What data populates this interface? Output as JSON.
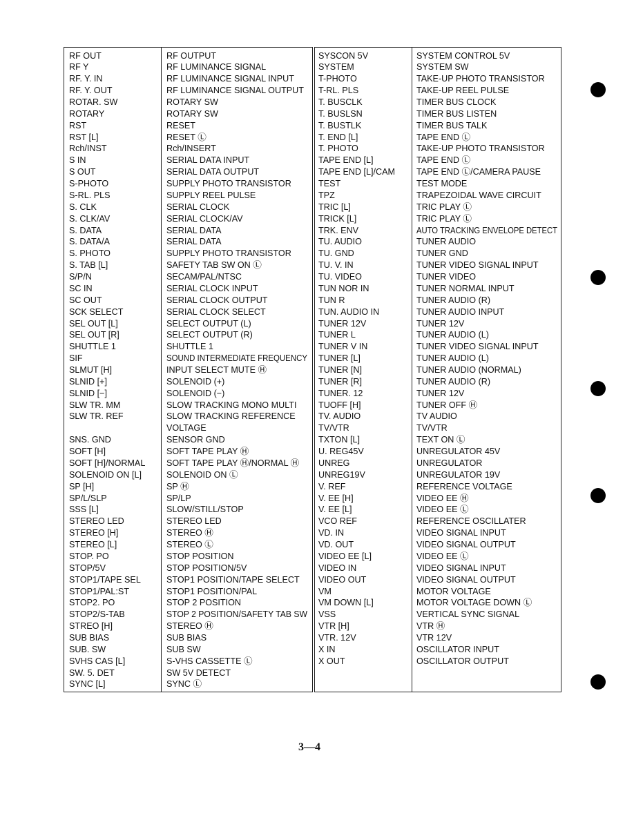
{
  "table_left": {
    "rows": [
      [
        "RF OUT",
        "RF OUTPUT"
      ],
      [
        "RF Y",
        "RF LUMINANCE SIGNAL"
      ],
      [
        "RF. Y. IN",
        "RF LUMINANCE SIGNAL INPUT"
      ],
      [
        "RF. Y. OUT",
        "RF LUMINANCE SIGNAL OUTPUT"
      ],
      [
        "ROTAR. SW",
        "ROTARY SW"
      ],
      [
        "ROTARY",
        "ROTARY SW"
      ],
      [
        "RST",
        "RESET"
      ],
      [
        "RST [L]",
        "RESET Ⓛ"
      ],
      [
        "Rch/INST",
        "Rch/INSERT"
      ],
      [
        "S IN",
        "SERIAL DATA INPUT"
      ],
      [
        "S OUT",
        "SERIAL DATA OUTPUT"
      ],
      [
        "S-PHOTO",
        "SUPPLY PHOTO TRANSISTOR"
      ],
      [
        "S-RL. PLS",
        "SUPPLY REEL PULSE"
      ],
      [
        "S. CLK",
        "SERIAL CLOCK"
      ],
      [
        "S. CLK/AV",
        "SERIAL CLOCK/AV"
      ],
      [
        "S. DATA",
        "SERIAL DATA"
      ],
      [
        "S. DATA/A",
        "SERIAL DATA"
      ],
      [
        "S. PHOTO",
        "SUPPLY PHOTO TRANSISTOR"
      ],
      [
        "S. TAB [L]",
        "SAFETY TAB SW ON Ⓛ"
      ],
      [
        "S/P/N",
        "SECAM/PAL/NTSC"
      ],
      [
        "SC IN",
        "SERIAL CLOCK INPUT"
      ],
      [
        "SC OUT",
        "SERIAL CLOCK OUTPUT"
      ],
      [
        "SCK SELECT",
        "SERIAL CLOCK SELECT"
      ],
      [
        "SEL OUT [L]",
        "SELECT OUTPUT (L)"
      ],
      [
        "SEL OUT [R]",
        "SELECT OUTPUT (R)"
      ],
      [
        "SHUTTLE 1",
        "SHUTTLE 1"
      ],
      [
        "SIF",
        "SOUND INTERMEDIATE FREQUENCY"
      ],
      [
        "SLMUT [H]",
        "INPUT SELECT MUTE Ⓗ"
      ],
      [
        "SLNID [+]",
        "SOLENOID (+)"
      ],
      [
        "SLNID [−]",
        "SOLENOID (−)"
      ],
      [
        "SLW TR. MM",
        "SLOW TRACKING MONO MULTI"
      ],
      [
        "SLW TR. REF",
        "SLOW TRACKING REFERENCE"
      ],
      [
        "",
        "VOLTAGE"
      ],
      [
        "SNS. GND",
        "SENSOR GND"
      ],
      [
        "SOFT [H]",
        "SOFT TAPE PLAY Ⓗ"
      ],
      [
        "SOFT [H]/NORMAL",
        "SOFT TAPE PLAY Ⓗ/NORMAL Ⓗ"
      ],
      [
        "SOLENOID ON [L]",
        "SOLENOID ON Ⓛ"
      ],
      [
        "SP [H]",
        "SP Ⓗ"
      ],
      [
        "SP/L/SLP",
        "SP/LP"
      ],
      [
        "SSS [L]",
        "SLOW/STILL/STOP"
      ],
      [
        "STEREO LED",
        "STEREO LED"
      ],
      [
        "STEREO [H]",
        "STEREO Ⓗ"
      ],
      [
        "STEREO [L]",
        "STEREO Ⓛ"
      ],
      [
        "STOP. PO",
        "STOP POSITION"
      ],
      [
        "STOP/5V",
        "STOP POSITION/5V"
      ],
      [
        "STOP1/TAPE SEL",
        "STOP1 POSITION/TAPE SELECT"
      ],
      [
        "STOP1/PAL:ST",
        "STOP1 POSITION/PAL"
      ],
      [
        "STOP2. PO",
        "STOP 2 POSITION"
      ],
      [
        "STOP2/S-TAB",
        "STOP 2 POSITION/SAFETY TAB SW"
      ],
      [
        "STREO [H]",
        "STEREO Ⓗ"
      ],
      [
        "SUB BIAS",
        "SUB BIAS"
      ],
      [
        "SUB. SW",
        "SUB SW"
      ],
      [
        "SVHS CAS [L]",
        "S-VHS CASSETTE Ⓛ"
      ],
      [
        "SW. 5. DET",
        "SW 5V DETECT"
      ],
      [
        "SYNC [L]",
        "SYNC Ⓛ"
      ]
    ]
  },
  "table_right": {
    "rows": [
      [
        "SYSCON 5V",
        "SYSTEM CONTROL 5V"
      ],
      [
        "SYSTEM",
        "SYSTEM SW"
      ],
      [
        "T-PHOTO",
        "TAKE-UP PHOTO TRANSISTOR"
      ],
      [
        "T-RL. PLS",
        "TAKE-UP REEL PULSE"
      ],
      [
        "T. BUSCLK",
        "TIMER BUS CLOCK"
      ],
      [
        "T. BUSLSN",
        "TIMER BUS LISTEN"
      ],
      [
        "T. BUSTLK",
        "TIMER BUS TALK"
      ],
      [
        "T. END [L]",
        "TAPE END Ⓛ"
      ],
      [
        "T. PHOTO",
        "TAKE-UP PHOTO TRANSISTOR"
      ],
      [
        "TAPE END [L]",
        "TAPE END Ⓛ"
      ],
      [
        "TAPE END [L]/CAM",
        "TAPE END Ⓛ/CAMERA PAUSE"
      ],
      [
        "TEST",
        "TEST MODE"
      ],
      [
        "TPZ",
        "TRAPEZOIDAL WAVE CIRCUIT"
      ],
      [
        "TRIC [L]",
        "TRIC PLAY Ⓛ"
      ],
      [
        "TRICK [L]",
        "TRIC PLAY Ⓛ"
      ],
      [
        "TRK. ENV",
        "AUTO TRACKING ENVELOPE DETECT"
      ],
      [
        "TU. AUDIO",
        "TUNER AUDIO"
      ],
      [
        "TU. GND",
        "TUNER GND"
      ],
      [
        "TU. V. IN",
        "TUNER VIDEO SIGNAL INPUT"
      ],
      [
        "TU. VIDEO",
        "TUNER VIDEO"
      ],
      [
        "TUN NOR IN",
        "TUNER NORMAL INPUT"
      ],
      [
        "TUN R",
        "TUNER AUDIO (R)"
      ],
      [
        "TUN. AUDIO IN",
        "TUNER AUDIO INPUT"
      ],
      [
        "TUNER 12V",
        "TUNER 12V"
      ],
      [
        "TUNER L",
        "TUNER AUDIO (L)"
      ],
      [
        "TUNER V IN",
        "TUNER VIDEO SIGNAL INPUT"
      ],
      [
        "TUNER [L]",
        "TUNER AUDIO (L)"
      ],
      [
        "TUNER [N]",
        "TUNER AUDIO (NORMAL)"
      ],
      [
        "TUNER [R]",
        "TUNER AUDIO (R)"
      ],
      [
        "TUNER. 12",
        "TUNER 12V"
      ],
      [
        "TUOFF [H]",
        "TUNER OFF Ⓗ"
      ],
      [
        "TV. AUDIO",
        "TV AUDIO"
      ],
      [
        "TV/VTR",
        "TV/VTR"
      ],
      [
        "TXTON [L]",
        "TEXT ON Ⓛ"
      ],
      [
        "U. REG45V",
        "UNREGULATOR 45V"
      ],
      [
        "UNREG",
        "UNREGULATOR"
      ],
      [
        "UNREG19V",
        "UNREGULATOR 19V"
      ],
      [
        "V. REF",
        "REFERENCE VOLTAGE"
      ],
      [
        "V. EE [H]",
        "VIDEO EE Ⓗ"
      ],
      [
        "V. EE [L]",
        "VIDEO EE Ⓛ"
      ],
      [
        "VCO REF",
        "REFERENCE OSCILLATER"
      ],
      [
        "VD. IN",
        "VIDEO SIGNAL INPUT"
      ],
      [
        "VD. OUT",
        "VIDEO SIGNAL OUTPUT"
      ],
      [
        "VIDEO EE [L]",
        "VIDEO EE Ⓛ"
      ],
      [
        "VIDEO IN",
        "VIDEO SIGNAL INPUT"
      ],
      [
        "VIDEO OUT",
        "VIDEO SIGNAL OUTPUT"
      ],
      [
        "VM",
        "MOTOR VOLTAGE"
      ],
      [
        "VM DOWN [L]",
        "MOTOR VOLTAGE DOWN Ⓛ"
      ],
      [
        "VSS",
        "VERTICAL SYNC SIGNAL"
      ],
      [
        "VTR [H]",
        "VTR Ⓗ"
      ],
      [
        "VTR. 12V",
        "VTR 12V"
      ],
      [
        "X IN",
        "OSCILLATOR INPUT"
      ],
      [
        "X OUT",
        "OSCILLATOR OUTPUT"
      ]
    ]
  },
  "page_number": "3—4"
}
